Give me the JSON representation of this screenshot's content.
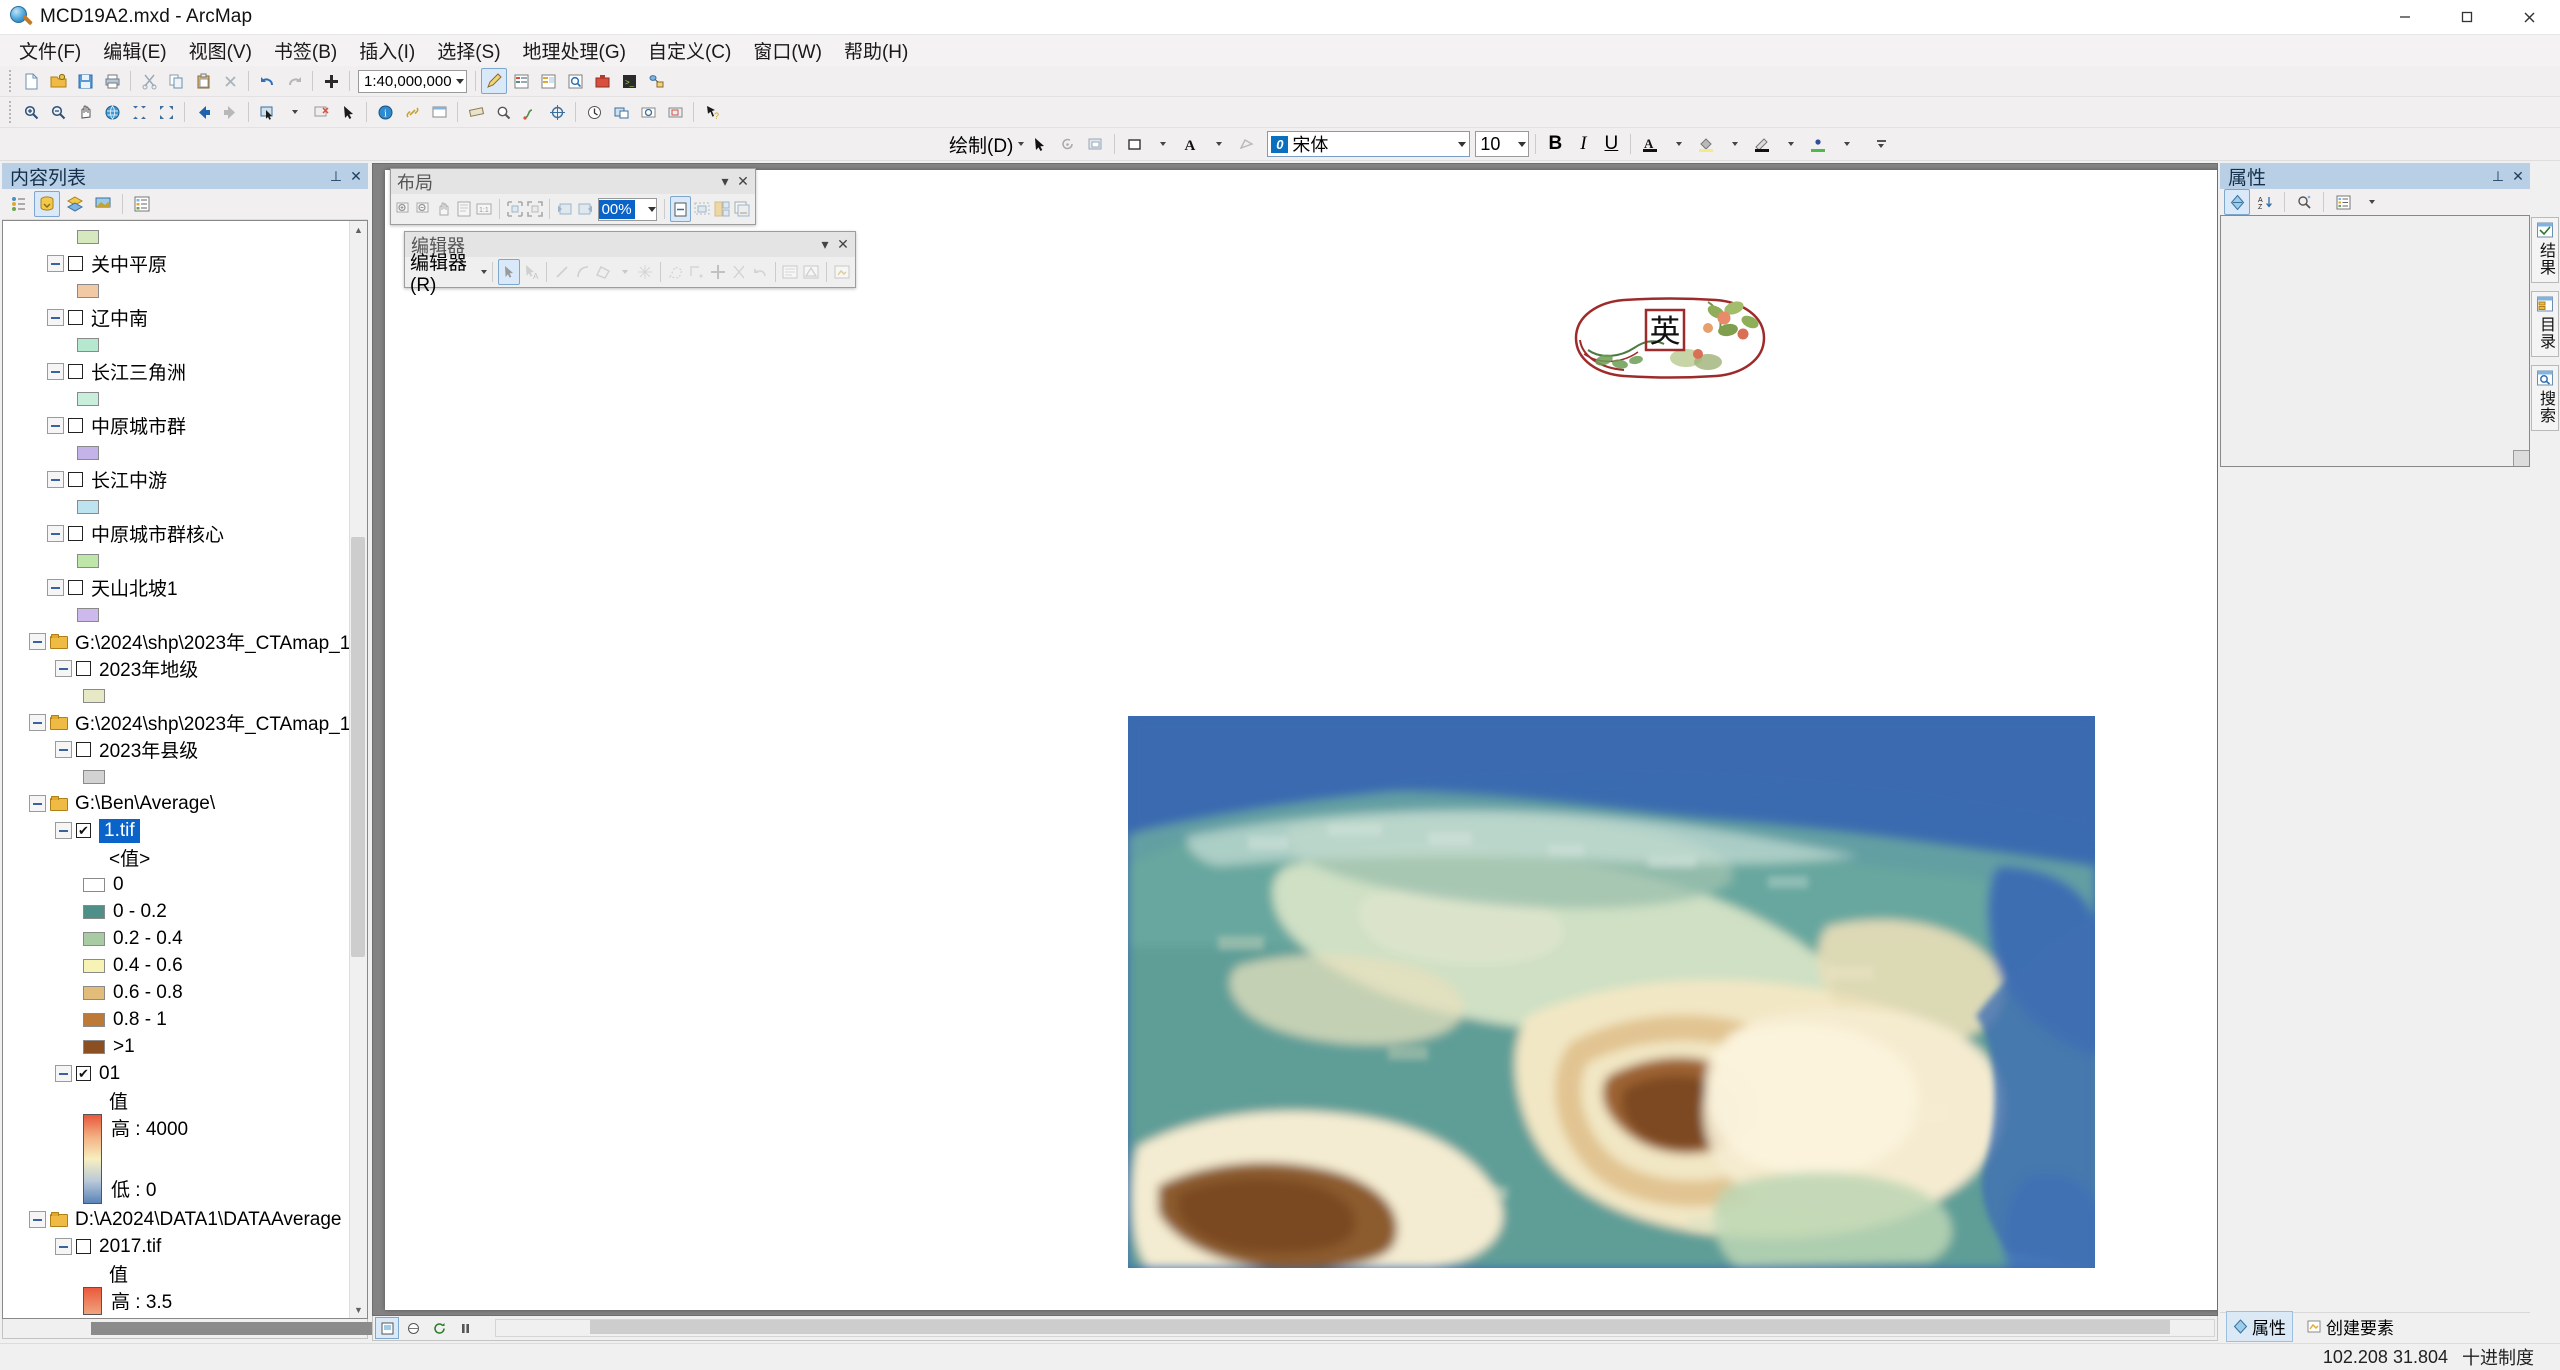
{
  "window": {
    "title": "MCD19A2.mxd - ArcMap",
    "app_icon": "arcmap-globe-icon",
    "controls": {
      "minimize": "–",
      "maximize": "□",
      "close": "✕"
    }
  },
  "menubar": {
    "items": [
      {
        "label": "文件(F)",
        "name": "menu-file"
      },
      {
        "label": "编辑(E)",
        "name": "menu-edit"
      },
      {
        "label": "视图(V)",
        "name": "menu-view"
      },
      {
        "label": "书签(B)",
        "name": "menu-bookmarks"
      },
      {
        "label": "插入(I)",
        "name": "menu-insert"
      },
      {
        "label": "选择(S)",
        "name": "menu-selection"
      },
      {
        "label": "地理处理(G)",
        "name": "menu-geoprocessing"
      },
      {
        "label": "自定义(C)",
        "name": "menu-customize"
      },
      {
        "label": "窗口(W)",
        "name": "menu-window"
      },
      {
        "label": "帮助(H)",
        "name": "menu-help"
      }
    ]
  },
  "standard_toolbar": {
    "scale_value": "1:40,000,000"
  },
  "draw_toolbar": {
    "draw_label": "绘制(D)",
    "font_name": "宋体",
    "font_size": "10",
    "bold": "B",
    "italic": "I",
    "underline": "U",
    "text_color": "A",
    "fill_color_glyph": "◆",
    "line_color_glyph": "✎",
    "marker_color_glyph": "•"
  },
  "toc": {
    "title": "内容列表",
    "pin": "⊥",
    "close": "✕",
    "tool_icons": [
      "list-by-drawing-order-icon",
      "list-by-source-icon",
      "list-by-visibility-icon",
      "list-by-selection-icon",
      "toc-options-icon"
    ],
    "rows": [
      {
        "kind": "swatch",
        "indent": 74,
        "color": "#d6e9be"
      },
      {
        "kind": "layer",
        "indent": 44,
        "label": "关中平原",
        "checked": false
      },
      {
        "kind": "swatch",
        "indent": 74,
        "color": "#f2c9a5"
      },
      {
        "kind": "layer",
        "indent": 44,
        "label": "辽中南",
        "checked": false
      },
      {
        "kind": "swatch",
        "indent": 74,
        "color": "#b5e8cf"
      },
      {
        "kind": "layer",
        "indent": 44,
        "label": "长江三角洲",
        "checked": false
      },
      {
        "kind": "swatch",
        "indent": 74,
        "color": "#c9efdc"
      },
      {
        "kind": "layer",
        "indent": 44,
        "label": "中原城市群",
        "checked": false
      },
      {
        "kind": "swatch",
        "indent": 74,
        "color": "#c3b3e8"
      },
      {
        "kind": "layer",
        "indent": 44,
        "label": "长江中游",
        "checked": false
      },
      {
        "kind": "swatch",
        "indent": 74,
        "color": "#bde2f0"
      },
      {
        "kind": "layer",
        "indent": 44,
        "label": "中原城市群核心",
        "checked": false
      },
      {
        "kind": "swatch",
        "indent": 74,
        "color": "#bfe6a9"
      },
      {
        "kind": "layer",
        "indent": 44,
        "label": "天山北坡1",
        "checked": false
      },
      {
        "kind": "swatch",
        "indent": 74,
        "color": "#cdb9ec"
      },
      {
        "kind": "folder",
        "indent": 26,
        "label": "G:\\2024\\shp\\2023年_CTAmap_1"
      },
      {
        "kind": "layer",
        "indent": 52,
        "label": "2023年地级",
        "checked": false
      },
      {
        "kind": "swatch",
        "indent": 80,
        "color": "#e7e8c6"
      },
      {
        "kind": "folder",
        "indent": 26,
        "label": "G:\\2024\\shp\\2023年_CTAmap_1"
      },
      {
        "kind": "layer",
        "indent": 52,
        "label": "2023年县级",
        "checked": false
      },
      {
        "kind": "swatch",
        "indent": 80,
        "color": "#d2d2d2"
      },
      {
        "kind": "folder",
        "indent": 26,
        "label": "G:\\Ben\\Average\\"
      },
      {
        "kind": "layer-selected",
        "indent": 52,
        "label": "1.tif",
        "checked": true
      },
      {
        "kind": "text",
        "indent": 106,
        "label": "<值>"
      },
      {
        "kind": "legend-cb",
        "indent": 80,
        "label": "0",
        "color": "#ffffff"
      },
      {
        "kind": "legend",
        "indent": 80,
        "label": "0 - 0.2",
        "color": "#4e8f87"
      },
      {
        "kind": "legend",
        "indent": 80,
        "label": "0.2 - 0.4",
        "color": "#a9cba4"
      },
      {
        "kind": "legend",
        "indent": 80,
        "label": "0.4 - 0.6",
        "color": "#f7f3b4"
      },
      {
        "kind": "legend",
        "indent": 80,
        "label": "0.6 - 0.8",
        "color": "#e2bd79"
      },
      {
        "kind": "legend",
        "indent": 80,
        "label": "0.8 - 1",
        "color": "#bd7a36"
      },
      {
        "kind": "legend",
        "indent": 80,
        "label": ">1",
        "color": "#8c4f22"
      },
      {
        "kind": "layer",
        "indent": 52,
        "label": "01",
        "checked": true
      },
      {
        "kind": "text",
        "indent": 106,
        "label": "值"
      },
      {
        "kind": "ramp",
        "indent": 80,
        "high_label": "高 : 4000",
        "low_label": "低 : 0",
        "ramp_colors": [
          "#e8583c",
          "#f3b183",
          "#f7efc0",
          "#b9c9d8",
          "#5b84b8"
        ]
      },
      {
        "kind": "folder",
        "indent": 26,
        "label": "D:\\A2024\\DATA1\\DATAAverage"
      },
      {
        "kind": "layer",
        "indent": 52,
        "label": "2017.tif",
        "checked": false
      },
      {
        "kind": "text",
        "indent": 106,
        "label": "值"
      },
      {
        "kind": "ramp-partial",
        "indent": 80,
        "high_label": "高 : 3.5",
        "color": "#ea5a3c"
      }
    ]
  },
  "layout_toolbar": {
    "title": "布局",
    "zoom_value": "00%",
    "collapse_glyph": "▾",
    "close_glyph": "✕",
    "buttons": [
      "zoom-in-icon",
      "zoom-out-icon",
      "pan-icon",
      "zoom-whole-page-icon",
      "zoom-100-icon",
      "fixed-zoom-in-icon",
      "fixed-zoom-out-icon",
      "go-back-icon",
      "go-forward-icon",
      "toggle-draft-mode-icon",
      "focus-data-frame-icon",
      "change-layout-icon",
      "data-driven-pages-icon"
    ]
  },
  "editor_toolbar": {
    "title": "编辑器",
    "menu_label": "编辑器(R)",
    "collapse_glyph": "▾",
    "close_glyph": "✕",
    "buttons": [
      "edit-tool-icon",
      "edit-annotation-icon",
      "straight-segment-icon",
      "arc-segment-icon",
      "trace-icon",
      "midpoint-icon",
      "construction-icon",
      "split-icon",
      "rotate-icon",
      "merge-icon",
      "undo-edit-icon",
      "attributes-icon",
      "sketch-properties-icon",
      "create-features-icon"
    ]
  },
  "attributes_panel": {
    "title": "属性",
    "pin": "⊥",
    "close": "✕",
    "tool_icons": [
      "attributes-icon",
      "sort-icon",
      "zoom-to-icon",
      "options-icon",
      "dropdown-icon"
    ],
    "tabs": [
      {
        "label": "属性",
        "name": "tab-attributes",
        "active": true,
        "icon": "attributes-tab-icon"
      },
      {
        "label": "创建要素",
        "name": "tab-create-features",
        "active": false,
        "icon": "create-features-tab-icon"
      }
    ]
  },
  "dock_strip": {
    "items": [
      {
        "label": "结果",
        "name": "dock-results",
        "icon": "results-icon"
      },
      {
        "label": "目录",
        "name": "dock-catalog",
        "icon": "catalog-icon"
      },
      {
        "label": "搜索",
        "name": "dock-search",
        "icon": "search-icon"
      }
    ]
  },
  "statusbar": {
    "coordinates": "102.208  31.804",
    "units": "十进制度"
  },
  "map": {
    "title_seal": "英",
    "legend_classes": [
      {
        "label": "0",
        "color": "#ffffff"
      },
      {
        "label": "0 - 0.2",
        "color": "#4e8f87"
      },
      {
        "label": "0.2 - 0.4",
        "color": "#a9cba4"
      },
      {
        "label": "0.4 - 0.6",
        "color": "#f7f3b4"
      },
      {
        "label": "0.6 - 0.8",
        "color": "#e2bd79"
      },
      {
        "label": "0.8 - 1",
        "color": "#bd7a36"
      },
      {
        "label": ">1",
        "color": "#8c4f22"
      }
    ]
  }
}
